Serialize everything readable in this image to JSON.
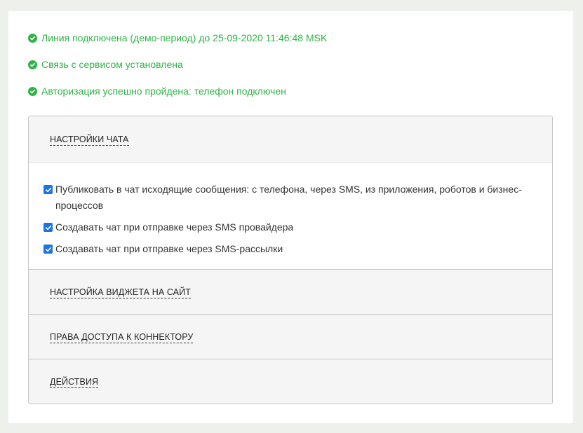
{
  "status": [
    {
      "text": "Линия подключена (демо-период) до 25-09-2020 11:46:48 MSK",
      "icon": "check-circle-icon"
    },
    {
      "text": "Связь с сервисом установлена",
      "icon": "check-circle-icon"
    },
    {
      "text": "Авторизация успешно пройдена: телефон подключен",
      "icon": "check-circle-icon"
    }
  ],
  "sections": [
    {
      "title": "НАСТРОЙКИ ЧАТА",
      "expanded": true
    },
    {
      "title": "НАСТРОЙКА ВИДЖЕТА НА САЙТ",
      "expanded": false
    },
    {
      "title": "ПРАВА ДОСТУПА К КОННЕКТОРУ",
      "expanded": false
    },
    {
      "title": "ДЕЙСТВИЯ",
      "expanded": false
    }
  ],
  "chat_settings": {
    "options": [
      {
        "label": "Публиковать в чат исходящие сообщения: с телефона, через SMS, из приложения, роботов и бизнес-процессов",
        "checked": true
      },
      {
        "label": "Создавать чат при отправке через SMS провайдера",
        "checked": true
      },
      {
        "label": "Создавать чат при отправке через SMS-рассылки",
        "checked": true
      }
    ]
  },
  "colors": {
    "success": "#2fb347",
    "checkbox": "#1a73e8",
    "header_bg": "#f5f5f5"
  }
}
